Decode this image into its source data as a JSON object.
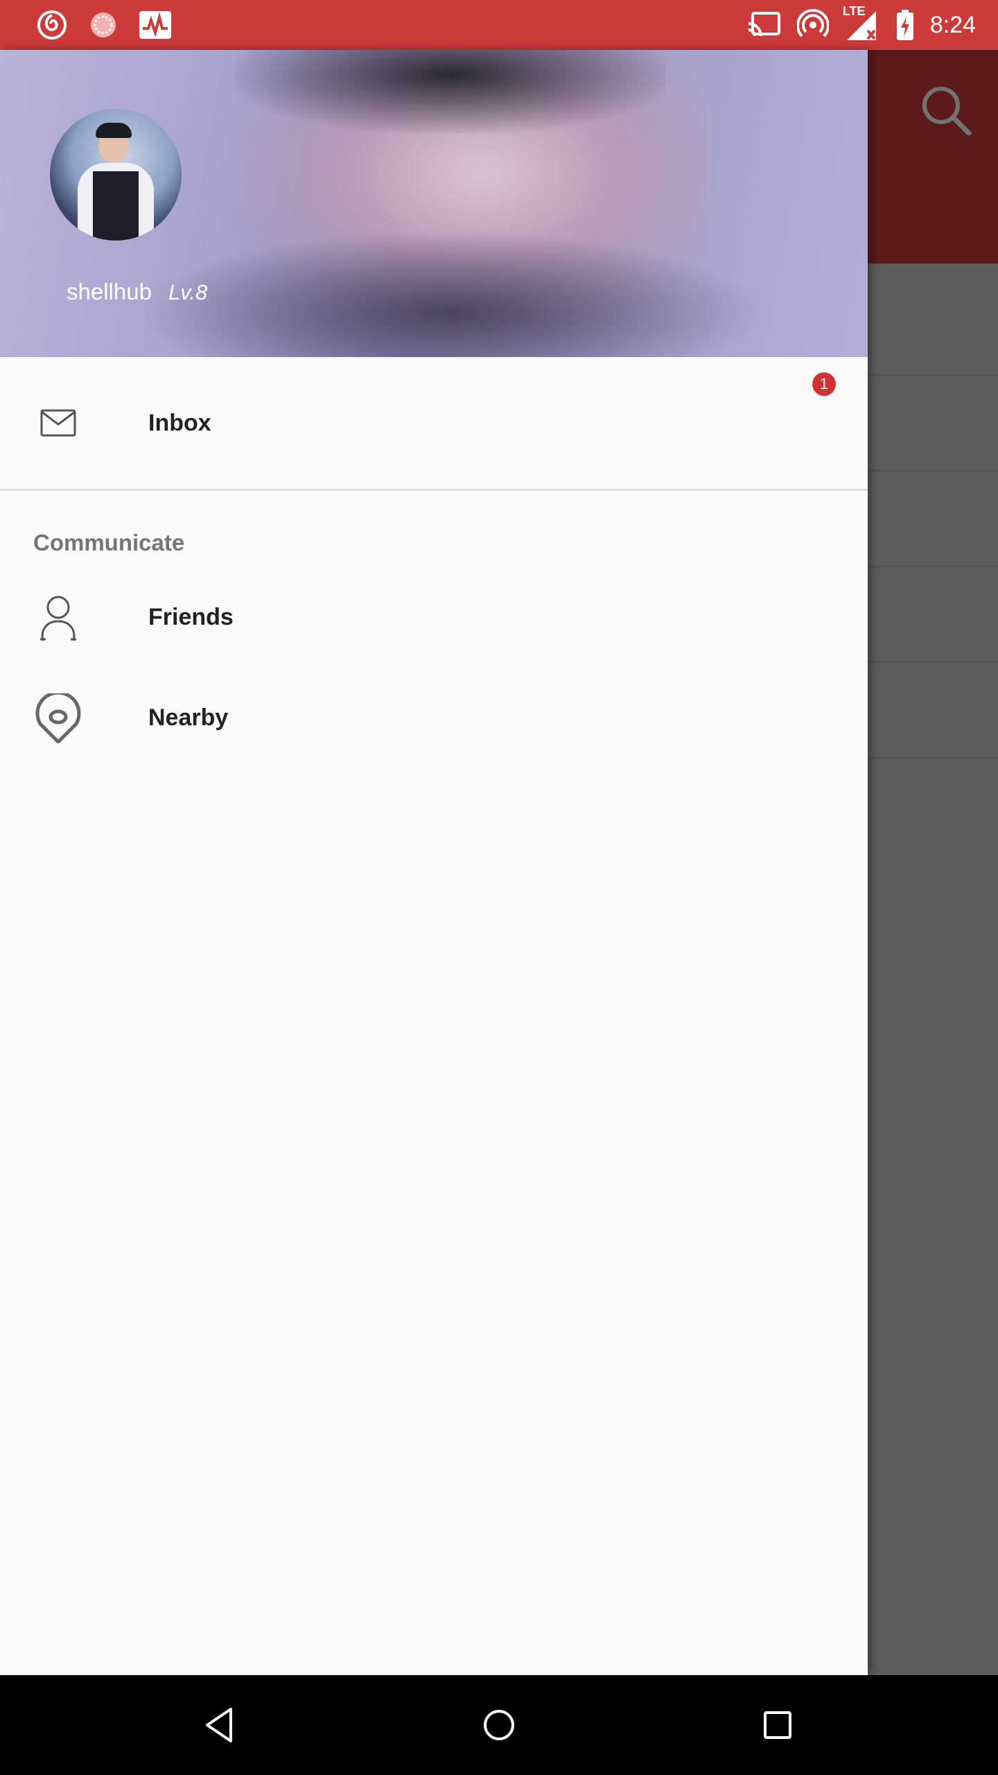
{
  "status_bar": {
    "time": "8:24",
    "network_label": "LTE",
    "icons": [
      "netease-music-icon",
      "loading-circle-icon",
      "activity-monitor-icon",
      "cast-icon",
      "hotspot-icon",
      "signal-icon",
      "battery-charging-icon"
    ]
  },
  "drawer": {
    "header": {
      "username": "shellhub",
      "level": "Lv.8"
    },
    "inbox": {
      "label": "Inbox",
      "badge": "1"
    },
    "sections": [
      {
        "title": "Communicate",
        "items": [
          {
            "label": "Friends",
            "icon": "person-icon"
          },
          {
            "label": "Nearby",
            "icon": "location-pin-icon"
          }
        ]
      }
    ]
  },
  "colors": {
    "primary": "#cd3a3a",
    "badge": "#d13232",
    "drawer_bg": "#fafafa",
    "nav_bar": "#000000"
  },
  "nav_bar": {
    "buttons": [
      "back-icon",
      "home-icon",
      "recents-icon"
    ]
  }
}
